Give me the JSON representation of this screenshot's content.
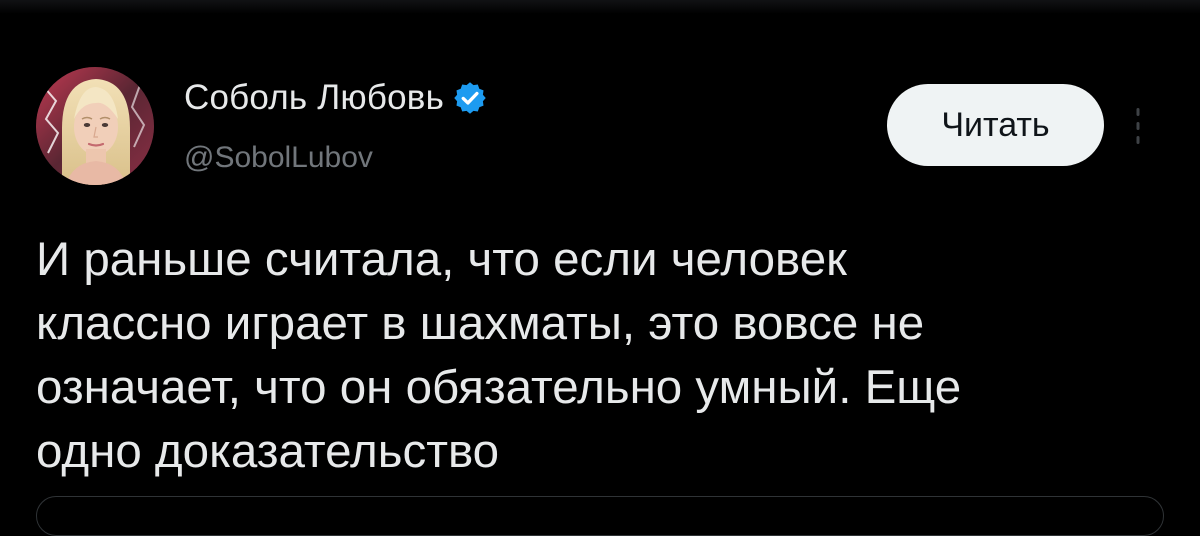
{
  "author": {
    "display_name": "Соболь Любовь",
    "handle": "@SobolLubov",
    "verified": true,
    "avatar_alt": "avatar"
  },
  "actions": {
    "follow_label": "Читать",
    "more_icon": "more-vertical-icon"
  },
  "tweet": {
    "text": "И раньше считала, что если человек\nклассно играет в шахматы, это вовсе не\nозначает, что он обязательно умный. Еще\nодно доказательство"
  },
  "colors": {
    "background": "#000000",
    "text_primary": "#e7e9ea",
    "text_secondary": "#71767b",
    "verified_badge": "#1d9bf0",
    "follow_button_bg": "#eff3f4",
    "follow_button_text": "#0f1419",
    "card_border": "#2f3336"
  }
}
